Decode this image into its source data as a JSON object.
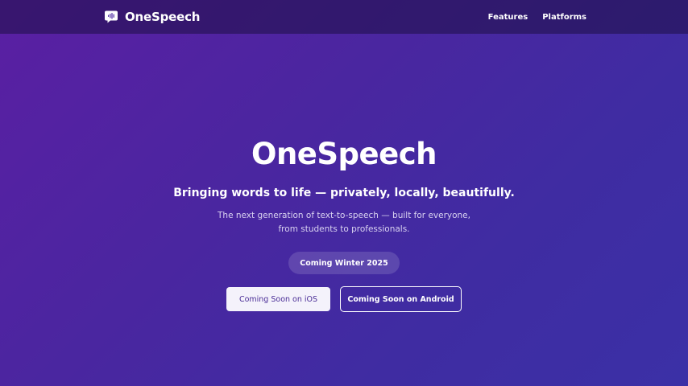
{
  "header": {
    "brand_name": "OneSpeech",
    "brand_icon": "speech-bubble-waveform-icon",
    "nav": [
      {
        "label": "Features"
      },
      {
        "label": "Platforms"
      }
    ]
  },
  "hero": {
    "title": "OneSpeech",
    "subtitle": "Bringing words to life — privately, locally, beautifully.",
    "description": "The next generation of text-to-speech — built for everyone, from students to professionals.",
    "badge": "Coming Winter 2025",
    "ios_button": "Coming Soon on iOS",
    "android_button": "Coming Soon on Android"
  },
  "colors": {
    "background_start": "#5a1fa3",
    "background_end": "#3b30a6",
    "navbar": "#2a1260",
    "ios_button_bg": "#f4f2fb",
    "ios_button_text": "#4a2d96"
  }
}
